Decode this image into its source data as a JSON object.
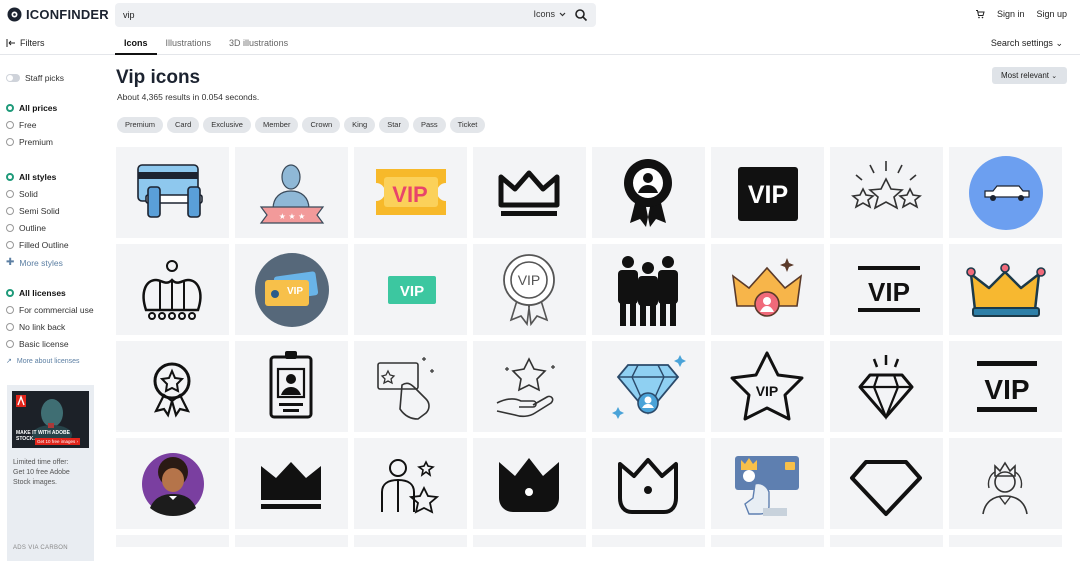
{
  "header": {
    "logo": "ICONFINDER",
    "search_value": "vip",
    "search_type": "Icons",
    "sign_in": "Sign in",
    "sign_up": "Sign up"
  },
  "subnav": {
    "filters": "Filters",
    "tabs": [
      "Icons",
      "Illustrations",
      "3D illustrations"
    ],
    "search_settings": "Search settings"
  },
  "sidebar": {
    "staff_picks": "Staff picks",
    "prices": [
      "All prices",
      "Free",
      "Premium"
    ],
    "styles": [
      "All styles",
      "Solid",
      "Semi Solid",
      "Outline",
      "Filled Outline"
    ],
    "more_styles": "More styles",
    "licenses": [
      "All licenses",
      "For commercial use",
      "No link back",
      "Basic license"
    ],
    "more_about_licenses": "More about licenses",
    "ad": {
      "headline": "MAKE IT WITH ADOBE STOCK.",
      "cta": "Get 10 free images ›",
      "text_lines": [
        "Limited time offer:",
        "Get 10 free Adobe",
        "Stock images."
      ],
      "footer": "ADS VIA CARBON"
    }
  },
  "main": {
    "title": "Vip icons",
    "results": "About 4,365 results in 0.054 seconds.",
    "sort": "Most relevant",
    "chips": [
      "Premium",
      "Card",
      "Exclusive",
      "Member",
      "Crown",
      "King",
      "Star",
      "Pass",
      "Ticket"
    ]
  },
  "icons": [
    "credit-card-dumbbell-icon",
    "person-on-podium-icon",
    "vip-ticket-icon",
    "crown-outline-icon",
    "award-badge-icon",
    "vip-black-label-icon",
    "stars-burst-icon",
    "limousine-icon",
    "crown-outline-round-icon",
    "vip-cards-icon",
    "vip-green-label-icon",
    "vip-rosette-icon",
    "vip-guards-icon",
    "crown-person-icon",
    "vip-text-lines-icon",
    "jeweled-crown-icon",
    "star-ribbon-badge-icon",
    "id-badge-icon",
    "card-in-hand-icon",
    "star-in-hand-icon",
    "diamond-person-icon",
    "vip-star-icon",
    "diamond-sparkle-icon",
    "vip-bold-text-icon",
    "afro-man-avatar-icon",
    "crown-solid-icon",
    "man-with-stars-icon",
    "crown-solid-dot-icon",
    "crown-outline-dot-icon",
    "card-in-hand-color-icon",
    "diamond-outline-icon",
    "queen-with-crown-icon"
  ],
  "colors": {
    "accent": "#1f9a7a",
    "link": "#5c7fa3"
  }
}
